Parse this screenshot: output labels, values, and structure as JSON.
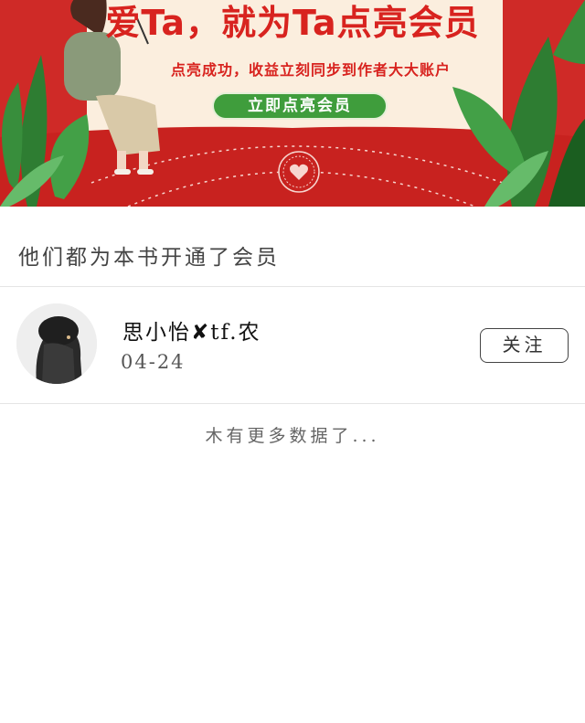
{
  "banner": {
    "title": "爱Ta，就为Ta点亮会员",
    "subtitle": "点亮成功，收益立刻同步到作者大大账户",
    "cta_label": "立即点亮会员",
    "colors": {
      "background": "#cf2a27",
      "card": "#fbeede",
      "cta": "#3f9d3c",
      "title": "#d8231f",
      "leaf": "#2e7d32"
    }
  },
  "section": {
    "title": "他们都为本书开通了会员"
  },
  "members": [
    {
      "name": "思小怡✘tf.农",
      "date": "04-24",
      "follow_label": "关注",
      "avatar_icon": "girl-avatar"
    }
  ],
  "footer": {
    "no_more_text": "木有更多数据了..."
  }
}
